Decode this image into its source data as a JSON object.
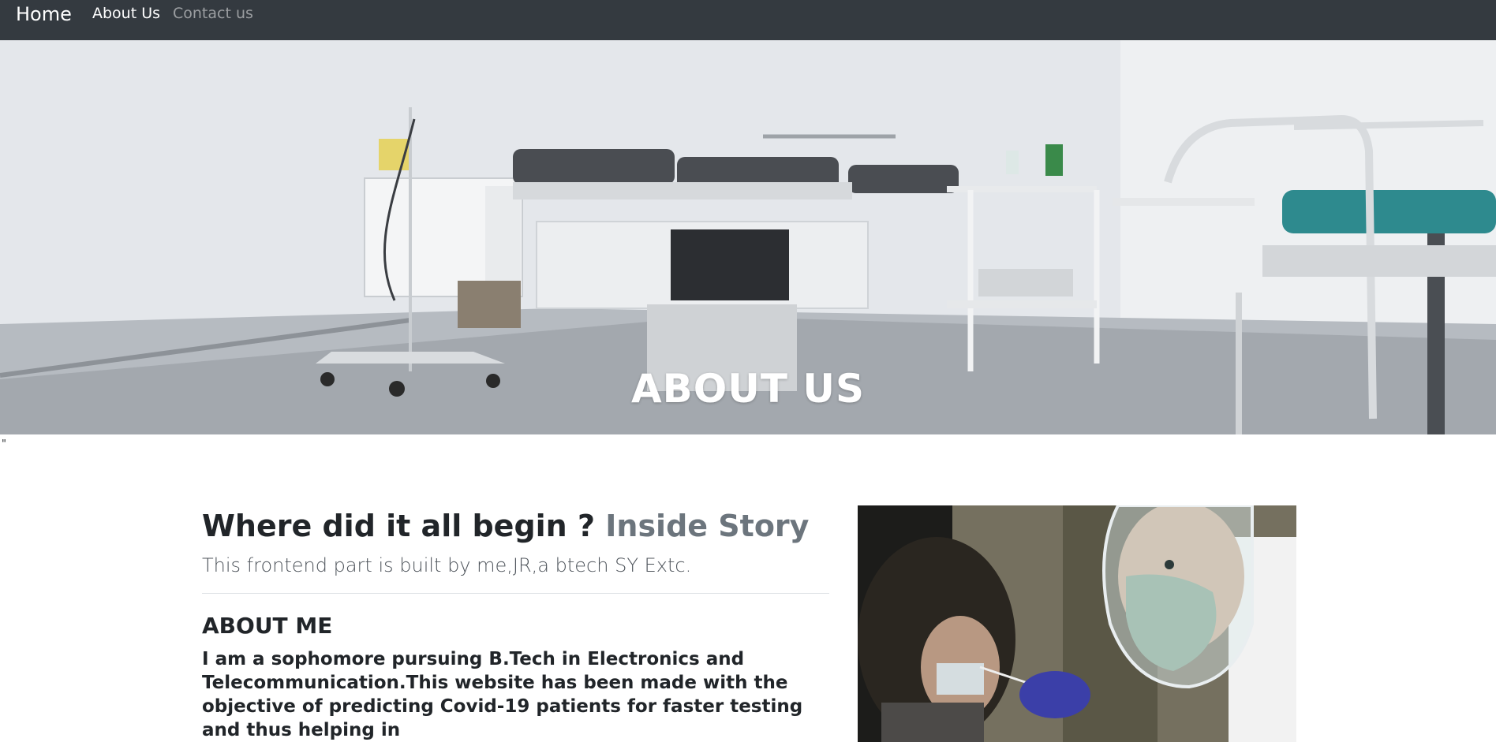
{
  "navbar": {
    "brand": "Home",
    "links": [
      {
        "label": "About Us",
        "active": true
      },
      {
        "label": "Contact us",
        "active": false
      }
    ],
    "background": "#343a40"
  },
  "hero": {
    "title": "ABOUT US",
    "stray_text": "\""
  },
  "story": {
    "heading": "Where did it all begin ?",
    "heading_muted": "Inside Story",
    "lead": "This frontend part is built by me,JR,a btech SY Extc.",
    "about_title": "ABOUT ME",
    "about_text": "I am a sophomore pursuing B.Tech in Electronics and Telecommunication.This website has been made with the objective of predicting Covid-19 patients for faster testing and thus helping in"
  },
  "colors": {
    "muted": "#6c757d",
    "text": "#212529",
    "accent_teal": "#2e8a8e"
  }
}
